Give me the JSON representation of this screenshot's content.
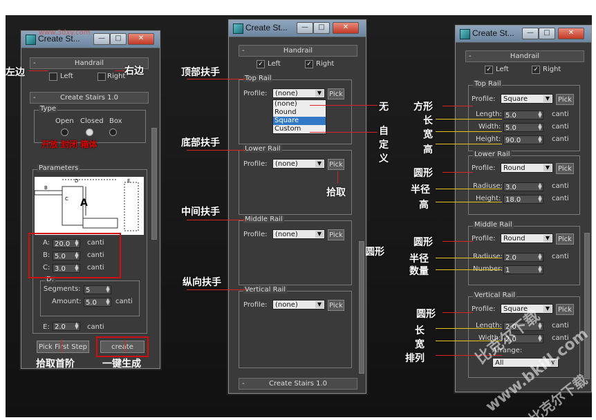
{
  "annotations": {
    "left_side": "左边",
    "right_side": "右边",
    "top_rail": "顶部扶手",
    "none": "无",
    "bottom_rail": "底部扶手",
    "custom": "自\n定\n义",
    "pick": "拾取",
    "middle_rail": "中间扶手",
    "round_mid": "圆形",
    "vertical_rail": "纵向扶手",
    "pick_first_step": "拾取首阶",
    "one_click": "一键生成",
    "square": "方形",
    "length": "长",
    "width": "宽",
    "height": "高",
    "round": "圆形",
    "radius": "半径",
    "height2": "高",
    "round2": "圆形",
    "radius2": "半径",
    "count": "数量",
    "round3": "圆形",
    "length2": "长",
    "width2": "宽",
    "arrange": "排列",
    "types_red": "开放 封闭 箱体"
  },
  "watermark": {
    "line1": "比克尔下载",
    "line2": "www.bkill.com",
    "line3": "比克尔下载",
    "url": "www.3dxy.com"
  },
  "win1": {
    "title": "Create St...",
    "handrail_label": "Handrail",
    "left": "Left",
    "right": "Right",
    "create_stairs": "Create Stairs 1.0",
    "type_label": "Type",
    "open": "Open",
    "closed": "Closed",
    "box": "Box",
    "parameters": "Parameters",
    "diag_a": "A",
    "diag_b": "B",
    "diag_c": "C",
    "diag_d": "D",
    "diag_e": "E",
    "a_label": "A:",
    "a_val": "20.0",
    "b_label": "B:",
    "b_val": "5.0",
    "c_label": "C:",
    "c_val": "3.0",
    "unit": "canti",
    "d_label": "D:",
    "segments_label": "Segments:",
    "segments_val": "5",
    "amount_label": "Amount:",
    "amount_val": "5.0",
    "e_label": "E:",
    "e_val": "2.0",
    "pick_first_step": "Pick First Step",
    "create": "create"
  },
  "win2": {
    "title": "Create St...",
    "handrail_label": "Handrail",
    "left": "Left",
    "right": "Right",
    "top_rail": "Top Rail",
    "profile": "Profile:",
    "none": "(none)",
    "pick": "Pick",
    "options": [
      "(none)",
      "Round",
      "Square",
      "Custom"
    ],
    "lower_rail": "Lower Rail",
    "middle_rail": "Middle Rail",
    "vertical_rail": "Vertical Rail",
    "create_stairs": "Create Stairs 1.0"
  },
  "win3": {
    "title": "Create St...",
    "handrail_label": "Handrail",
    "left": "Left",
    "right": "Right",
    "top_rail": "Top Rail",
    "profile": "Profile:",
    "pick": "Pick",
    "square": "Square",
    "length_label": "Length:",
    "length_val": "5.0",
    "width_label": "Width:",
    "width_val": "5.0",
    "height_label": "Height:",
    "height_val": "90.0",
    "unit": "canti",
    "lower_rail": "Lower Rail",
    "round": "Round",
    "radius_label": "Radiuse:",
    "radius_val": "3.0",
    "lheight_label": "Height:",
    "lheight_val": "18.0",
    "middle_rail": "Middle Rail",
    "mround": "Round",
    "mradius_label": "Radiuse:",
    "mradius_val": "2.0",
    "number_label": "Number:",
    "number_val": "1",
    "vertical_rail": "Vertical Rail",
    "vsquare": "Square",
    "vlength_label": "Length:",
    "vlength_val": "2.0",
    "vwidth_label": "Width:",
    "vwidth_val": "2.0",
    "arrange_label": "Arrange:",
    "arrange_val": "All"
  }
}
